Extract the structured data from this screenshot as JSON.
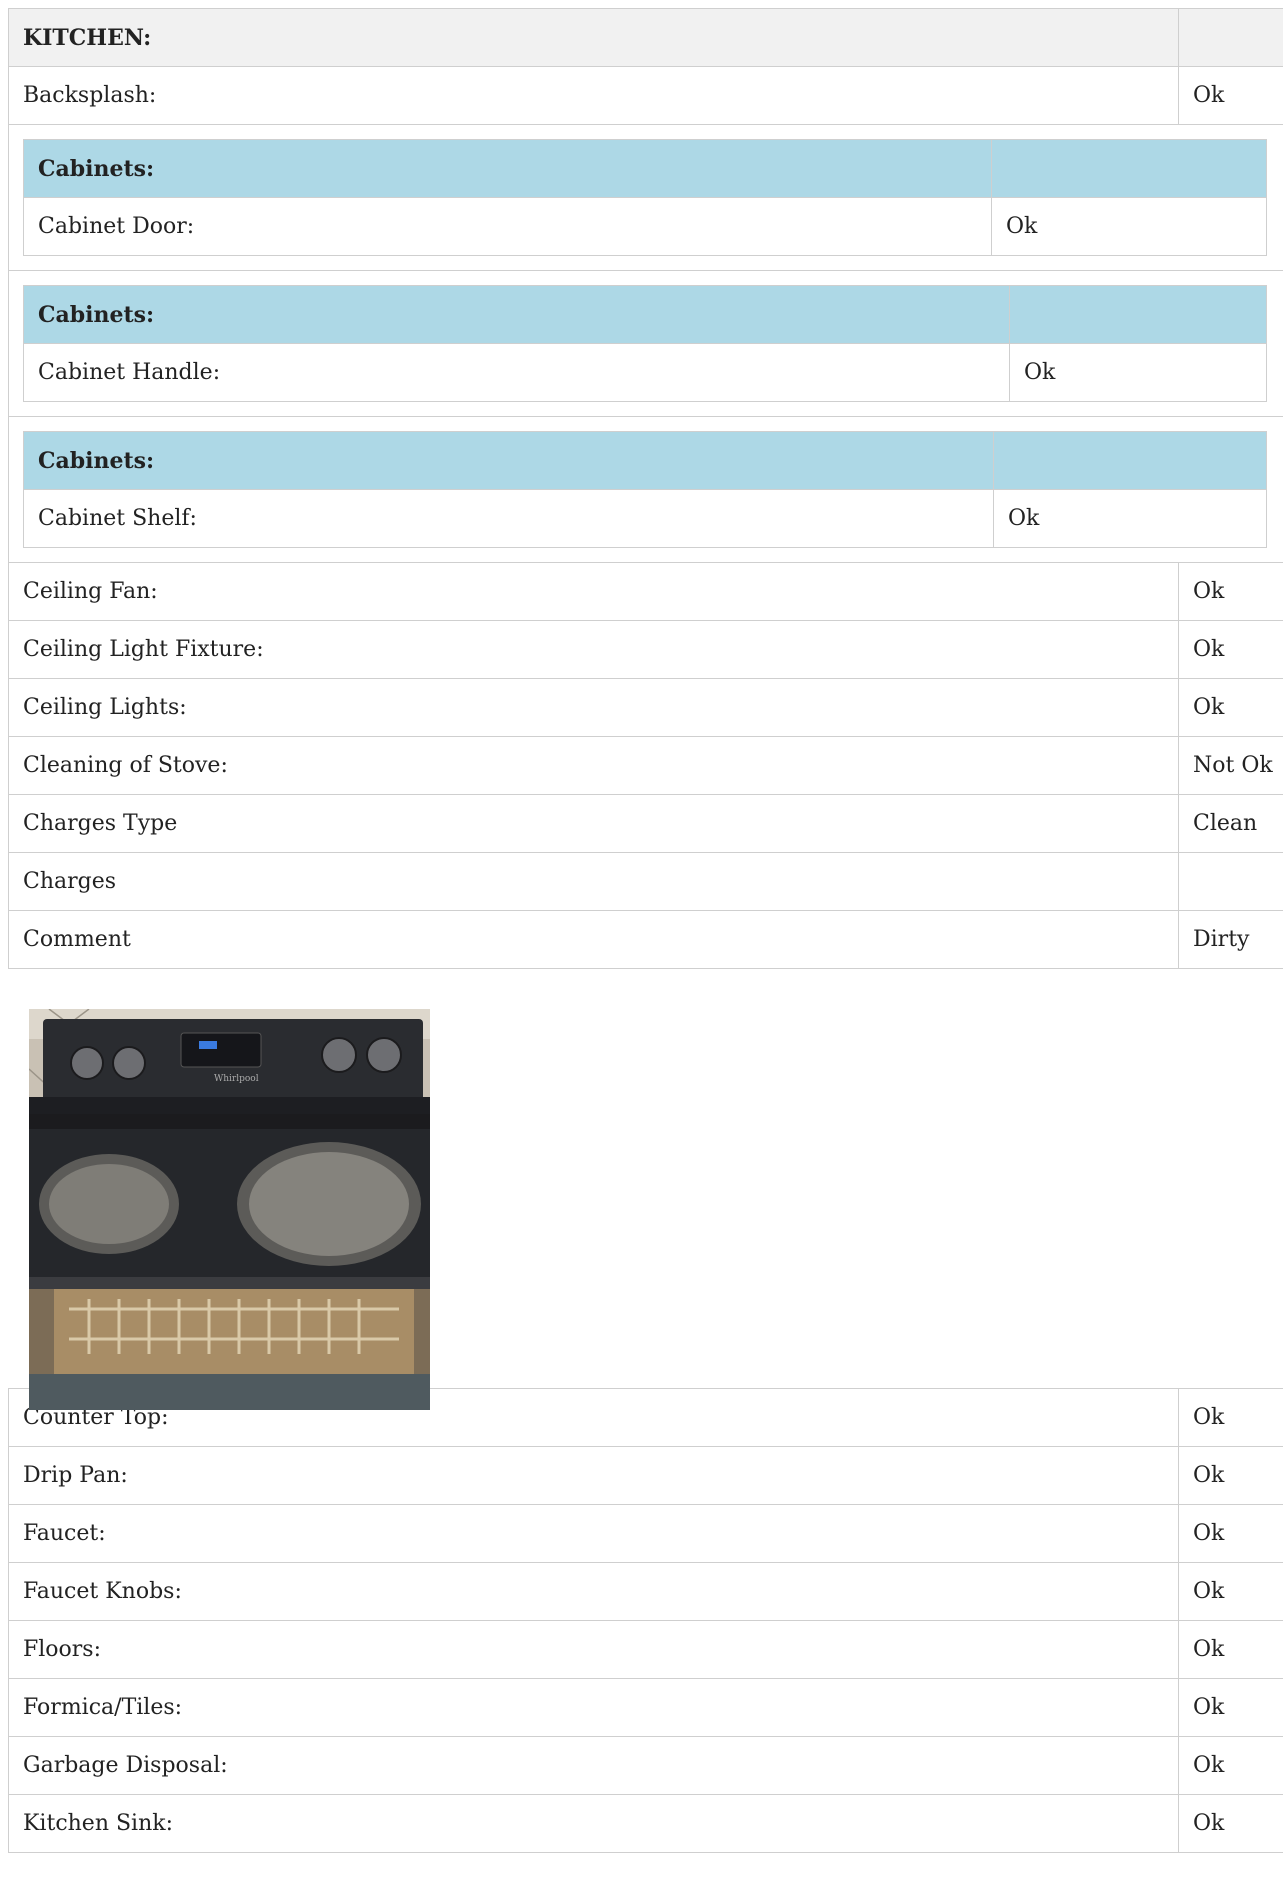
{
  "section_title": "KITCHEN:",
  "backsplash": {
    "label": "Backsplash:",
    "value": "Ok"
  },
  "cabinets": [
    {
      "header": "Cabinets:",
      "label": "Cabinet Door:",
      "value": "Ok"
    },
    {
      "header": "Cabinets:",
      "label": "Cabinet Handle:",
      "value": "Ok"
    },
    {
      "header": "Cabinets:",
      "label": "Cabinet Shelf:",
      "value": "Ok"
    }
  ],
  "rows_before_photo": [
    {
      "label": "Ceiling Fan:",
      "value": "Ok"
    },
    {
      "label": "Ceiling Light Fixture:",
      "value": "Ok"
    },
    {
      "label": "Ceiling Lights:",
      "value": "Ok"
    },
    {
      "label": "Cleaning of Stove:",
      "value": "Not Ok"
    },
    {
      "label": "Charges Type",
      "value": "Clean"
    },
    {
      "label": "Charges",
      "value": ""
    },
    {
      "label": "Comment",
      "value": "Dirty"
    }
  ],
  "photo": {
    "subject": "stove-photo",
    "brand_text": "Whirlpool"
  },
  "rows_after_photo": [
    {
      "label": "Counter Top:",
      "value": "Ok"
    },
    {
      "label": "Drip Pan:",
      "value": "Ok"
    },
    {
      "label": "Faucet:",
      "value": "Ok"
    },
    {
      "label": "Faucet Knobs:",
      "value": "Ok"
    },
    {
      "label": "Floors:",
      "value": "Ok"
    },
    {
      "label": "Formica/Tiles:",
      "value": "Ok"
    },
    {
      "label": "Garbage Disposal:",
      "value": "Ok"
    },
    {
      "label": "Kitchen Sink:",
      "value": "Ok"
    }
  ]
}
